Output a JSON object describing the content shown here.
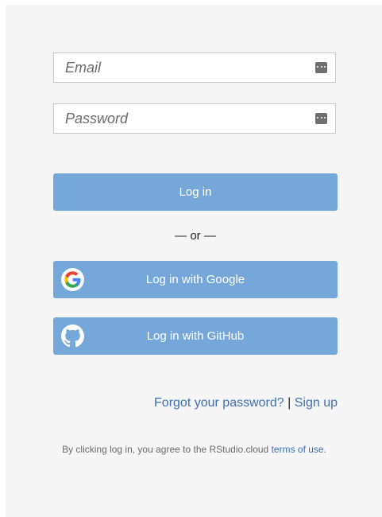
{
  "login_form": {
    "email": {
      "placeholder": "Email",
      "value": "",
      "icon": "password-manager-icon"
    },
    "password": {
      "placeholder": "Password",
      "value": "",
      "icon": "password-manager-icon"
    },
    "login_button_label": "Log in",
    "separator_text": "— or —",
    "google_button": {
      "label": "Log in with Google",
      "icon": "google-logo-icon"
    },
    "github_button": {
      "label": "Log in with GitHub",
      "icon": "github-logo-icon"
    }
  },
  "links": {
    "forgot_password": "Forgot your password?",
    "divider": "|",
    "sign_up": "Sign up"
  },
  "terms": {
    "prefix": "By clicking log in, you agree to the RStudio.cloud",
    "link": "terms of use",
    "suffix": "."
  },
  "colors": {
    "button": "#75a8d8",
    "panel_background": "#f5f5f5",
    "link": "#3d6fb0"
  }
}
